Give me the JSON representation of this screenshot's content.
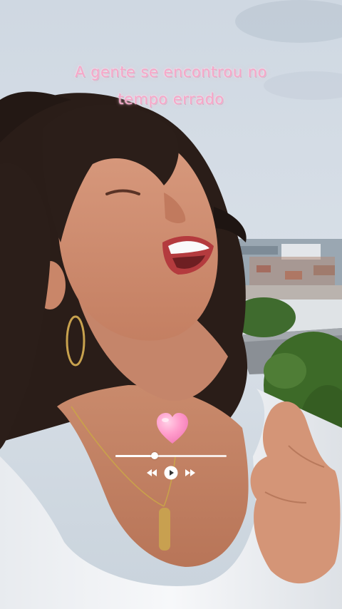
{
  "caption": {
    "line1": "A gente se encontrou no",
    "line2": "tempo errado"
  },
  "overlay": {
    "sticker_icon": "heart-icon",
    "accent_color": "#f7a6c8",
    "heart_color": "#ff8fc4"
  },
  "player": {
    "progress": 0.35,
    "controls": [
      "rewind-icon",
      "play-icon",
      "fast-forward-icon"
    ]
  }
}
